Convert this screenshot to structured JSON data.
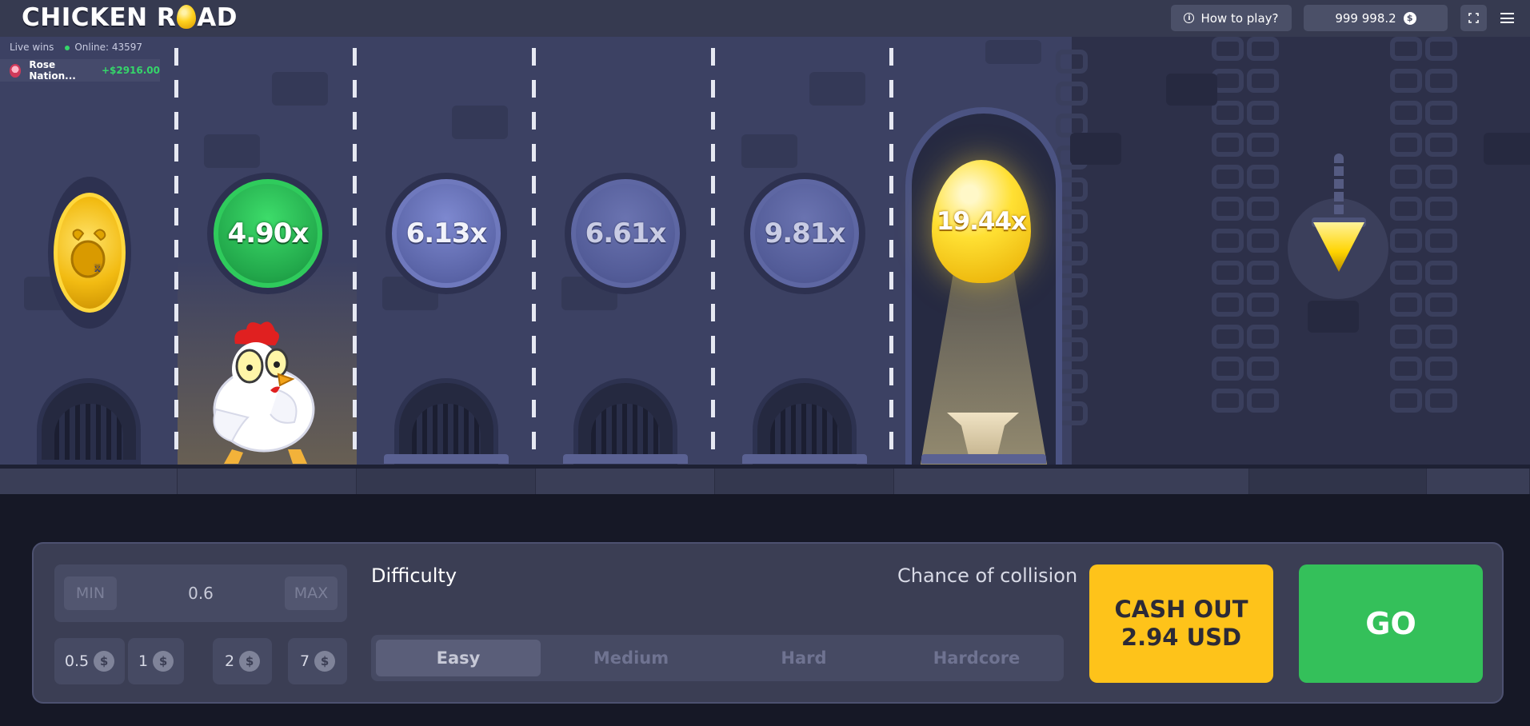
{
  "header": {
    "logo_part1": "CHICKEN R",
    "logo_part2": "AD",
    "how_to_play": "How to play?",
    "balance": "999 998.2",
    "currency_symbol": "$"
  },
  "live": {
    "title": "Live wins",
    "online": "Online: 43597",
    "entries": [
      {
        "name": "Rose Nation...",
        "amount": "+$2916.00"
      }
    ]
  },
  "lanes": {
    "multipliers": [
      "4.90x",
      "6.13x",
      "6.61x",
      "9.81x",
      "19.44x"
    ],
    "current_index": 0
  },
  "controls": {
    "min_label": "MIN",
    "max_label": "MAX",
    "bet_value": "0.6",
    "chips": [
      "0.5",
      "1",
      "2",
      "7"
    ],
    "difficulty_label": "Difficulty",
    "chance_label": "Chance of collision",
    "difficulties": [
      "Easy",
      "Medium",
      "Hard",
      "Hardcore"
    ],
    "selected_difficulty": "Easy",
    "cashout_line1": "CASH OUT",
    "cashout_line2": "2.94 USD",
    "go_label": "GO"
  },
  "colors": {
    "accent_yellow": "#fec31a",
    "accent_green": "#34c05a",
    "win_green": "#35d66a"
  }
}
